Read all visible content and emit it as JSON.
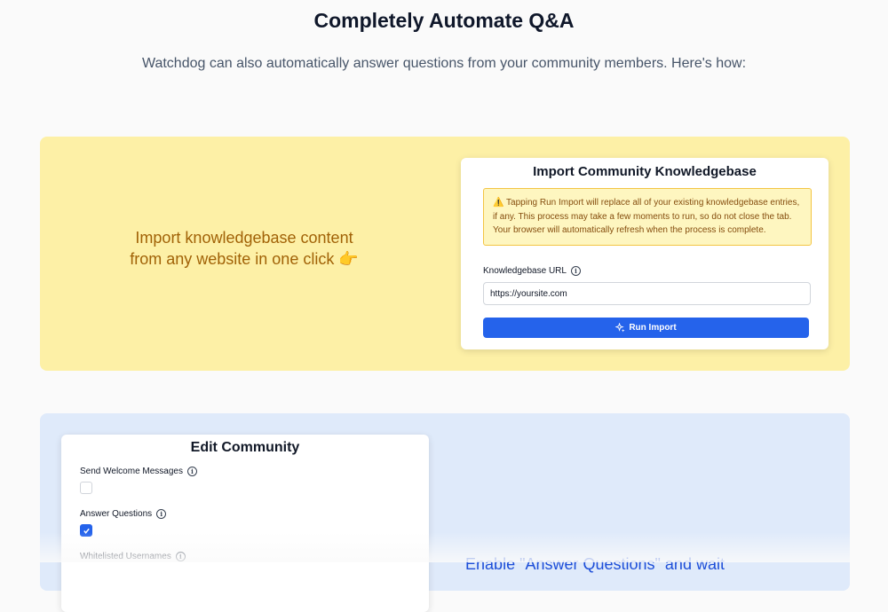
{
  "header": {
    "title": "Completely Automate Q&A",
    "subtitle": "Watchdog can also automatically answer questions from your community members. Here's how:"
  },
  "import_section": {
    "feature_text_line1": "Import knowledgebase content",
    "feature_text_line2": "from any website in one click 👉",
    "card": {
      "title": "Import Community Knowledgebase",
      "warning": "⚠️ Tapping Run Import will replace all of your existing knowledgebase entries, if any. This process may take a few moments to run, so do not close the tab. Your browser will automatically refresh when the process is complete.",
      "url_label": "Knowledgebase URL",
      "url_value": "https://yoursite.com",
      "run_button_label": "Run Import"
    }
  },
  "answer_section": {
    "feature_text": "Enable \"Answer Questions\" and wait",
    "card": {
      "title": "Edit Community",
      "fields": [
        {
          "label": "Send Welcome Messages",
          "checked": false
        },
        {
          "label": "Answer Questions",
          "checked": true
        },
        {
          "label": "Whitelisted Usernames"
        }
      ]
    }
  },
  "colors": {
    "yellow_panel": "#fdf0a6",
    "blue_panel": "#dfeafa",
    "primary_button": "#2563eb",
    "import_text": "#a16207",
    "answer_text": "#1d4ed8"
  },
  "icons": [
    "info-icon",
    "sparkle-icon",
    "checkmark-icon",
    "pointing-right-emoji",
    "warning-emoji"
  ]
}
